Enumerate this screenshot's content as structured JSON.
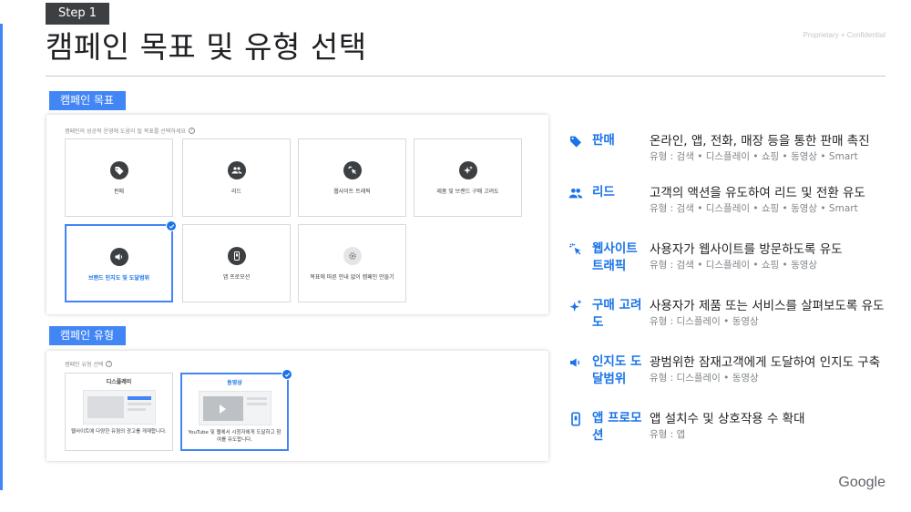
{
  "header": {
    "step": "Step 1",
    "title": "캠페인 목표 및 유형 선택",
    "confidential": "Proprietary + Confidential"
  },
  "goal_section": {
    "label": "캠페인 목표",
    "hint": "캠페인의 성공적 운영에 도움이 될 목표를 선택하세요",
    "cards": [
      {
        "label": "판매",
        "icon": "tag-icon"
      },
      {
        "label": "리드",
        "icon": "people-icon"
      },
      {
        "label": "웹사이트 트래픽",
        "icon": "cursor-click-icon"
      },
      {
        "label": "제품 및 브랜드 구매 고려도",
        "icon": "sparkle-icon"
      },
      {
        "label": "브랜드 인지도 및 도달범위",
        "icon": "speaker-icon",
        "selected": true
      },
      {
        "label": "앱 프로모션",
        "icon": "phone-icon"
      },
      {
        "label": "목표에 따른 안내 없이 캠페인 만들기",
        "icon": "gear-icon"
      }
    ]
  },
  "type_section": {
    "label": "캠페인 유형",
    "hint": "캠페인 유형 선택",
    "cards": [
      {
        "label": "디스플레이",
        "desc": "웹사이트에 다양한 유형의 광고를 게재합니다.",
        "icon": "display-thumbnail-icon"
      },
      {
        "label": "동영상",
        "desc": "YouTube 및 웹에서 시청자에게 도달하고 참여를 유도합니다.",
        "selected": true,
        "icon": "video-thumbnail-icon"
      }
    ]
  },
  "goal_list": [
    {
      "name": "판매",
      "desc": "온라인, 앱, 전화, 매장 등을 통한 판매 촉진",
      "types": "유형 : 검색 • 디스플레이 • 쇼핑 • 동영상 • Smart",
      "icon": "tag-icon"
    },
    {
      "name": "리드",
      "desc": "고객의 액션을 유도하여 리드 및 전환 유도",
      "types": "유형 : 검색 • 디스플레이 • 쇼핑 • 동영상 • Smart",
      "icon": "people-icon"
    },
    {
      "name": "웹사이트 트래픽",
      "desc": "사용자가 웹사이트를 방문하도록 유도",
      "types": "유형 : 검색 • 디스플레이 • 쇼핑 • 동영상",
      "icon": "cursor-click-icon"
    },
    {
      "name": "구매 고려도",
      "desc": "사용자가 제품 또는 서비스를 살펴보도록 유도",
      "types": "유형 : 디스플레이 • 동영상",
      "icon": "sparkle-icon"
    },
    {
      "name": "인지도 도달범위",
      "desc": "광범위한 잠재고객에게 도달하여 인지도 구축",
      "types": "유형 : 디스플레이 • 동영상",
      "icon": "speaker-icon"
    },
    {
      "name": "앱 프로모션",
      "desc": "앱 설치수 및 상호작용 수 확대",
      "types": "유형 : 앱",
      "icon": "phone-icon"
    }
  ],
  "footer": {
    "logo": "Google"
  },
  "colors": {
    "accent": "#4285f4",
    "link": "#1a73e8",
    "dark": "#3c4043"
  }
}
